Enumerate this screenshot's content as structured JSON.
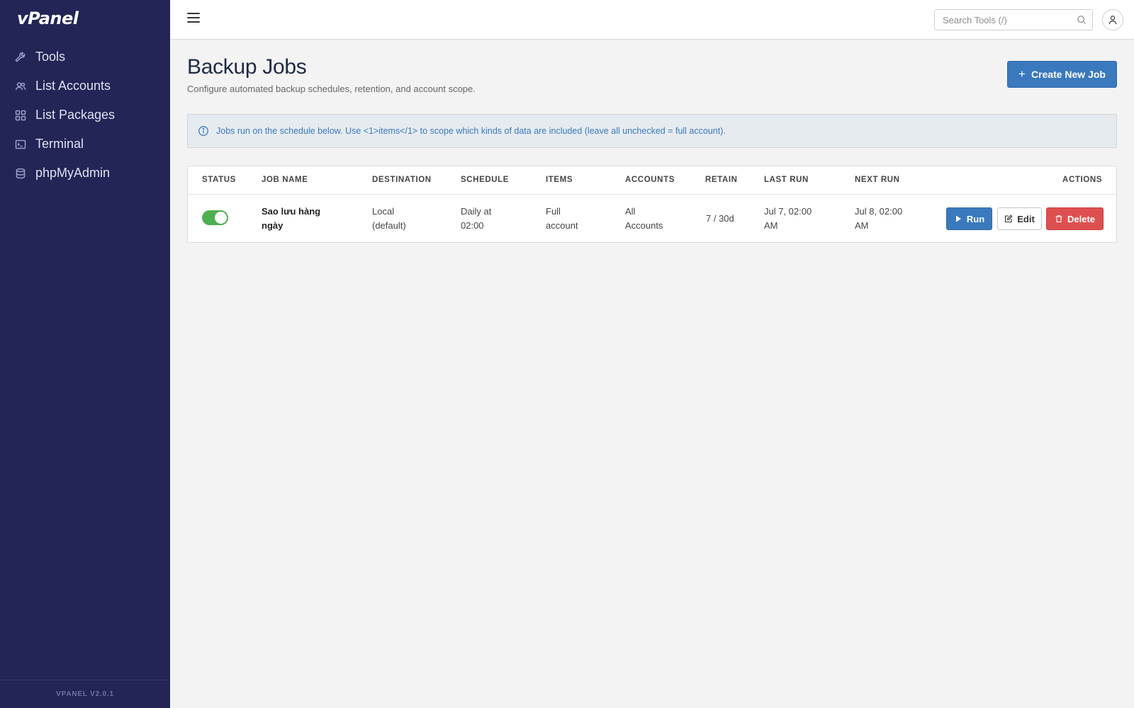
{
  "app": {
    "logo_text": "vPanel",
    "version": "VPANEL V2.0.1"
  },
  "sidebar": {
    "items": [
      {
        "label": "Tools",
        "icon": "wrench-icon"
      },
      {
        "label": "List Accounts",
        "icon": "users-icon"
      },
      {
        "label": "List Packages",
        "icon": "grid-icon"
      },
      {
        "label": "Terminal",
        "icon": "terminal-icon"
      },
      {
        "label": "phpMyAdmin",
        "icon": "database-icon"
      }
    ]
  },
  "topbar": {
    "search_placeholder": "Search Tools (/)",
    "menu_icon": "hamburger-icon",
    "user_icon": "user-icon"
  },
  "page": {
    "title": "Backup Jobs",
    "subtitle": "Configure automated backup schedules, retention, and account scope.",
    "create_button": "Create New Job",
    "info_text": "Jobs run on the schedule below. Use <1>items</1> to scope which kinds of data are included (leave all unchecked = full account)."
  },
  "table": {
    "headers": {
      "status": "STATUS",
      "job_name": "JOB NAME",
      "destination": "DESTINATION",
      "schedule": "SCHEDULE",
      "items": "ITEMS",
      "accounts": "ACCOUNTS",
      "retain": "RETAIN",
      "last_run": "LAST RUN",
      "next_run": "NEXT RUN",
      "actions": "ACTIONS"
    },
    "rows": [
      {
        "enabled": true,
        "job_name_1": "Sao lưu hàng",
        "job_name_2": "ngày",
        "destination_1": "Local",
        "destination_2": "(default)",
        "schedule_1": "Daily at",
        "schedule_2": "02:00",
        "items_1": "Full",
        "items_2": "account",
        "accounts_1": "All",
        "accounts_2": "Accounts",
        "retain": "7 / 30d",
        "last_run_1": "Jul 7, 02:00",
        "last_run_2": "AM",
        "next_run_1": "Jul 8, 02:00",
        "next_run_2": "AM",
        "run_label": "Run",
        "edit_label": "Edit",
        "delete_label": "Delete"
      }
    ]
  },
  "colors": {
    "sidebar_bg": "#222555",
    "primary": "#3a79bd",
    "danger": "#de5050",
    "toggle_on": "#4caf50"
  }
}
